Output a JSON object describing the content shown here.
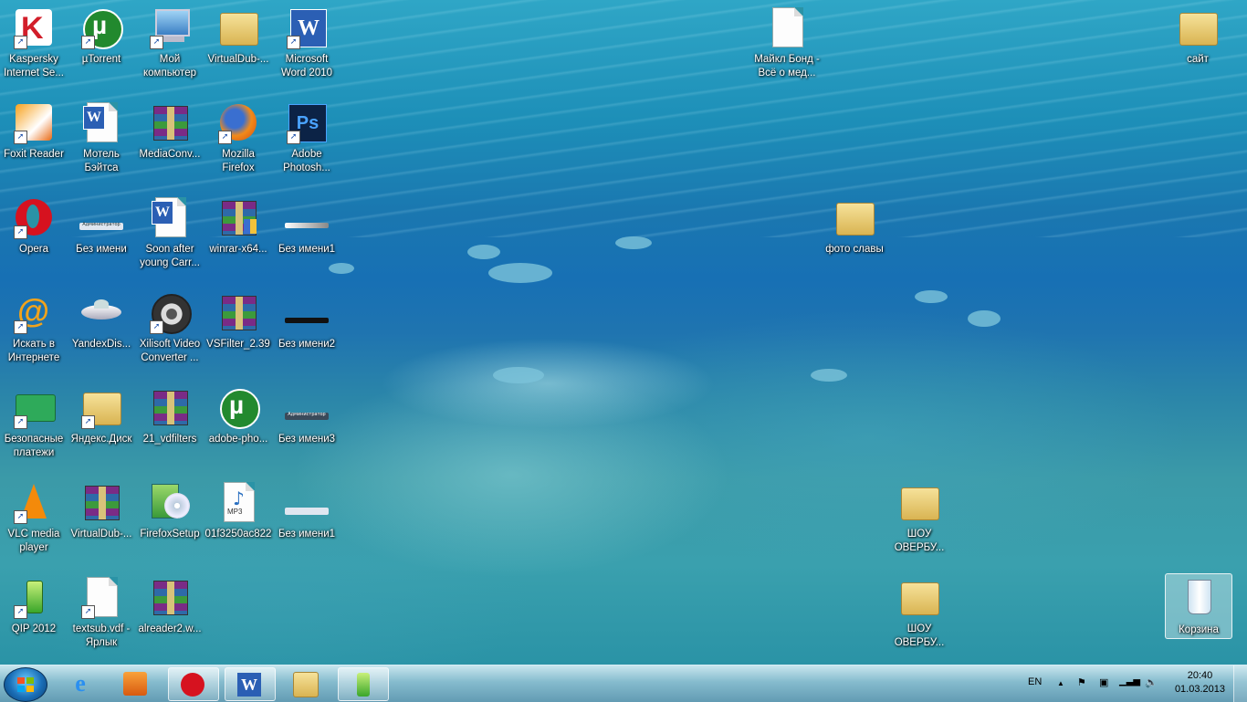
{
  "desktop": {
    "icons": {
      "kaspersky": "Kaspersky Internet Se...",
      "utorrent": "µTorrent",
      "my_computer": "Мой компьютер",
      "virtualdub_folder": "VirtualDub-...",
      "word2010": "Microsoft Word 2010",
      "foxit": "Foxit Reader",
      "motel": "Мотель Бэйтса",
      "mediaconv": "MediaConv...",
      "firefox": "Mozilla Firefox",
      "photoshop": "Adobe Photosh...",
      "opera": "Opera",
      "bez_imeni": "Без имени",
      "soon_after": "Soon after young Carr...",
      "winrar": "winrar-x64...",
      "bez_imeni1a": "Без имени1",
      "search_internet": "Искать в Интернете",
      "yandexdisk_shortcut": "YandexDis...",
      "xilisoft": "Xilisoft Video Converter ...",
      "vsfilter": "VSFilter_2.39",
      "bez_imeni2": "Без имени2",
      "safe_payments": "Безопасные платежи",
      "yandex_disk": "Яндекс.Диск",
      "vdfilters": "21_vdfilters",
      "adobe_pho": "adobe-pho...",
      "bez_imeni3": "Без имени3",
      "vlc": "VLC media player",
      "virtualdub_rar": "VirtualDub-...",
      "firefoxsetup": "FirefoxSetup",
      "mp3": "01f3250ac822",
      "bez_imeni1b": "Без имени1",
      "qip": "QIP 2012",
      "textsub": "textsub.vdf - Ярлык",
      "alreader": "alreader2.w...",
      "michael_bond": "Майкл Бонд - Всё о мед...",
      "sait": "сайт",
      "foto_slavy": "фото славы",
      "show1": "ШОУ ОВЕРБУ...",
      "show2": "ШОУ ОВЕРБУ...",
      "recycle": "Корзина"
    },
    "mini_labels": {
      "admin": "Администратор"
    }
  },
  "taskbar": {
    "pinned": [
      "windows-explorer",
      "internet-explorer",
      "media-player",
      "opera",
      "word",
      "explorer-folder",
      "qip"
    ],
    "tray": {
      "language": "EN",
      "time": "20:40",
      "date": "01.03.2013"
    },
    "file_types": {
      "mp3": "MP3",
      "ps": "Ps",
      "word": "W"
    }
  }
}
